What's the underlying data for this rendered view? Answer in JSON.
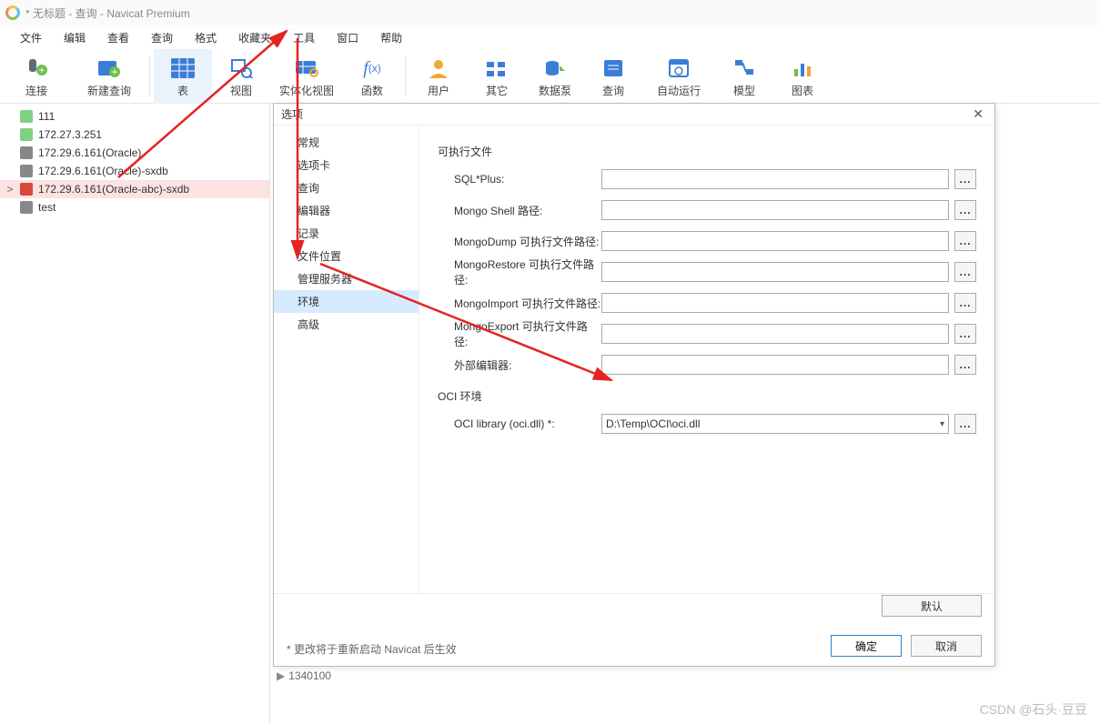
{
  "title": "* 无标题 - 查询 - Navicat Premium",
  "menubar": [
    "文件",
    "编辑",
    "查看",
    "查询",
    "格式",
    "收藏夹",
    "工具",
    "窗口",
    "帮助"
  ],
  "toolbar": [
    {
      "label": "连接",
      "key": "connect"
    },
    {
      "label": "新建查询",
      "key": "newquery"
    },
    {
      "label": "表",
      "key": "table",
      "active": true
    },
    {
      "label": "视图",
      "key": "view"
    },
    {
      "label": "实体化视图",
      "key": "matview"
    },
    {
      "label": "函数",
      "key": "func"
    },
    {
      "label": "用户",
      "key": "user"
    },
    {
      "label": "其它",
      "key": "other"
    },
    {
      "label": "数据泵",
      "key": "pump"
    },
    {
      "label": "查询",
      "key": "query"
    },
    {
      "label": "自动运行",
      "key": "auto"
    },
    {
      "label": "模型",
      "key": "model"
    },
    {
      "label": "图表",
      "key": "chart"
    }
  ],
  "sidebar": {
    "items": [
      {
        "label": "111",
        "color": "#7fd17f"
      },
      {
        "label": "172.27.3.251",
        "color": "#7fd17f"
      },
      {
        "label": "172.29.6.161(Oracle)",
        "color": "#888"
      },
      {
        "label": "172.29.6.161(Oracle)-sxdb",
        "color": "#888"
      },
      {
        "label": "172.29.6.161(Oracle-abc)-sxdb",
        "color": "#d9463e",
        "selected": true,
        "expand": ">"
      },
      {
        "label": "test",
        "color": "#888"
      }
    ]
  },
  "dialog": {
    "title": "选项",
    "nav": [
      "常规",
      "选项卡",
      "查询",
      "编辑器",
      "记录",
      "文件位置",
      "管理服务器",
      "环境",
      "高级"
    ],
    "nav_selected": "环境",
    "section1": "可执行文件",
    "fields": [
      {
        "label": "SQL*Plus:",
        "value": ""
      },
      {
        "label": "Mongo Shell 路径:",
        "value": ""
      },
      {
        "label": "MongoDump 可执行文件路径:",
        "value": ""
      },
      {
        "label": "MongoRestore 可执行文件路径:",
        "value": ""
      },
      {
        "label": "MongoImport 可执行文件路径:",
        "value": ""
      },
      {
        "label": "MongoExport 可执行文件路径:",
        "value": ""
      },
      {
        "label": "外部编辑器:",
        "value": ""
      }
    ],
    "section2": "OCI 环境",
    "oci_label": "OCI library (oci.dll) *:",
    "oci_value": "D:\\Temp\\OCI\\oci.dll",
    "note": "* 更改将于重新启动 Navicat 后生效",
    "default_btn": "默认",
    "ok": "确定",
    "cancel": "取消"
  },
  "bottom_value": "1340100",
  "watermark": "CSDN @石头·豆豆"
}
